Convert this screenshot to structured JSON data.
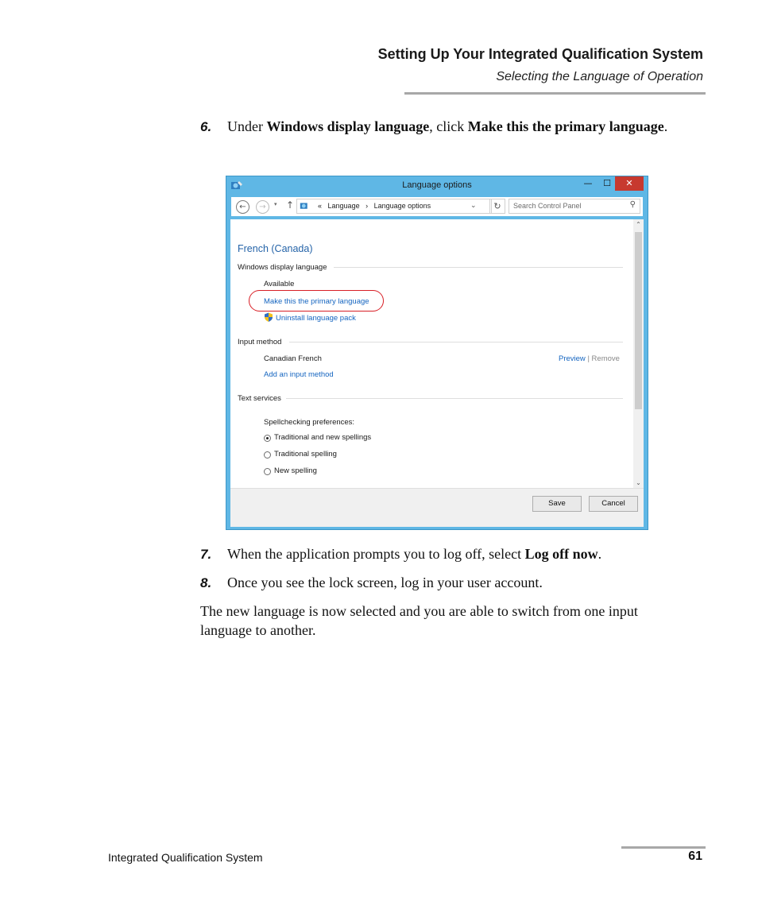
{
  "header": {
    "title": "Setting Up Your Integrated Qualification System",
    "subtitle": "Selecting the Language of Operation"
  },
  "steps": [
    {
      "number": "6.",
      "parts": [
        "Under ",
        "Windows display language",
        ", click ",
        "Make this the primary language",
        "."
      ]
    },
    {
      "number": "7.",
      "parts": [
        "When the application prompts you to log off, select ",
        "Log off now",
        "."
      ]
    },
    {
      "number": "8.",
      "text": "Once you see the lock screen, log in your user account."
    }
  ],
  "paragraph": "The new language is now selected and you are able to switch from one input language to another.",
  "window": {
    "title": "Language options",
    "controls": {
      "minimize": "—",
      "maximize": "☐",
      "close": "✕"
    },
    "nav": {
      "back": "←",
      "forward": "→",
      "dropdown": "▾",
      "up": "↑"
    },
    "address": {
      "prefix": "«",
      "crumbs": [
        "Language",
        "Language options"
      ],
      "separator": "›",
      "caret": "⌄"
    },
    "refresh": "↻",
    "search_placeholder": "Search Control Panel",
    "search_icon": "⚲",
    "content": {
      "language_name": "French (Canada)",
      "display_section": "Windows display language",
      "available": "Available",
      "make_primary": "Make this the primary language",
      "uninstall": "Uninstall language pack",
      "input_section": "Input method",
      "input_name": "Canadian French",
      "preview": "Preview",
      "link_separator": "|",
      "remove": "Remove",
      "add_input": "Add an input method",
      "text_section": "Text services",
      "spell_label": "Spellchecking preferences:",
      "options": [
        {
          "label": "Traditional and new spellings",
          "selected": true
        },
        {
          "label": "Traditional spelling",
          "selected": false
        },
        {
          "label": "New spelling",
          "selected": false
        }
      ]
    },
    "scroll": {
      "up": "⌃",
      "down": "⌄"
    },
    "buttons": {
      "save": "Save",
      "cancel": "Cancel"
    },
    "colors": {
      "frame": "#5fb7e5",
      "close": "#c7392f",
      "link": "#1565c0",
      "heading": "#2463a8",
      "highlight": "#d81f26"
    }
  },
  "footer": {
    "left": "Integrated Qualification System",
    "page": "61"
  }
}
